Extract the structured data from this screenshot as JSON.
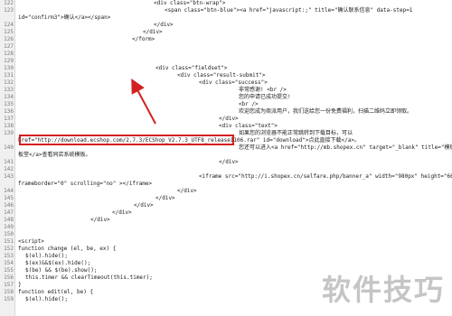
{
  "editor": {
    "lines": [
      {
        "n": "122",
        "indent": 150,
        "text": "<div class=\"btn-wrap\">"
      },
      {
        "n": "123",
        "indent": 162,
        "text": "<span class=\"btn-blue\"><a href=\"javascript:;\" title=\"确认联系信息\" data-step=1"
      },
      {
        "n": "",
        "indent": 0,
        "text": "id=\"confirm3\">确认</a></span>"
      },
      {
        "n": "124",
        "indent": 150,
        "text": "</div>"
      },
      {
        "n": "125",
        "indent": 138,
        "text": "</div>"
      },
      {
        "n": "126",
        "indent": 126,
        "text": "</form>"
      },
      {
        "n": "127",
        "indent": 0,
        "text": ""
      },
      {
        "n": "128",
        "indent": 0,
        "text": ""
      },
      {
        "n": "129",
        "indent": 0,
        "text": ""
      },
      {
        "n": "130",
        "indent": 152,
        "text": "<div class=\"fieldset\">"
      },
      {
        "n": "131",
        "indent": 176,
        "text": "<div class=\"result-submit\">"
      },
      {
        "n": "132",
        "indent": 200,
        "text": "<div class=\"success\">"
      },
      {
        "n": "133",
        "indent": 244,
        "text": "非常感谢! <br />"
      },
      {
        "n": "134",
        "indent": 244,
        "text": "您的申请已成功提交!"
      },
      {
        "n": "135",
        "indent": 244,
        "text": "<br />"
      },
      {
        "n": "136",
        "indent": 244,
        "text": "欢迎您成为商派用户，我们送给您一份免费福利，扫描二维码立即领取。"
      },
      {
        "n": "137",
        "indent": 222,
        "text": "</div>"
      },
      {
        "n": "138",
        "indent": 222,
        "text": "<div class=\"text\">"
      },
      {
        "n": "139",
        "indent": 244,
        "text": "如果您的浏览器不能正常跳转到下载目标，可以"
      },
      {
        "n": "",
        "indent": 0,
        "text": "href=\"http://download.ecshop.com/2.7.3/ECShop_V2.7.3_UTF8_release1106.rar\" id=\"download\">点此直接下载</a>。"
      },
      {
        "n": "140",
        "indent": 244,
        "text": "您还可以进入<a href=\"http://mb.shopex.cn\" target=\"_blank\" title=\"模板堂\">模"
      },
      {
        "n": "",
        "indent": 0,
        "text": "板堂</a>查看同店系统模板。"
      },
      {
        "n": "141",
        "indent": 222,
        "text": "</div>"
      },
      {
        "n": "142",
        "indent": 0,
        "text": ""
      },
      {
        "n": "143",
        "indent": 200,
        "text": "<iframe src=\"http://i.shopex.cn/selfare.php/banner_a\" width=\"980px\" height=\"660px\""
      },
      {
        "n": "",
        "indent": 0,
        "text": "frameborder=\"0\" scrolling=\"no\" ></iframe>"
      },
      {
        "n": "144",
        "indent": 176,
        "text": "</div>"
      },
      {
        "n": "145",
        "indent": 152,
        "text": "</div>"
      },
      {
        "n": "146",
        "indent": 128,
        "text": "</div>"
      },
      {
        "n": "147",
        "indent": 104,
        "text": "</div>"
      },
      {
        "n": "148",
        "indent": 80,
        "text": "</div>"
      },
      {
        "n": "149",
        "indent": 0,
        "text": ""
      },
      {
        "n": "150",
        "indent": 0,
        "text": ""
      },
      {
        "n": "151",
        "indent": 0,
        "text": "<script>"
      },
      {
        "n": "152",
        "indent": 0,
        "text": "function change (el, be, ex) {"
      },
      {
        "n": "153",
        "indent": 8,
        "text": "$(el).hide();"
      },
      {
        "n": "154",
        "indent": 8,
        "text": "$(ex)&&$(ex).hide();"
      },
      {
        "n": "155",
        "indent": 8,
        "text": "$(be) && $(be).show();"
      },
      {
        "n": "156",
        "indent": 8,
        "text": "this.timer && clearTimeout(this.timer);"
      },
      {
        "n": "157",
        "indent": 0,
        "text": "}"
      },
      {
        "n": "158",
        "indent": 0,
        "text": "function edit(el, be) {"
      },
      {
        "n": "159",
        "indent": 8,
        "text": "$(el).hide();"
      }
    ]
  },
  "watermark": {
    "text": "软件技巧"
  },
  "colors": {
    "highlight": "#d32020",
    "arrow": "#d32020",
    "gutter": "#f0f0f0"
  }
}
